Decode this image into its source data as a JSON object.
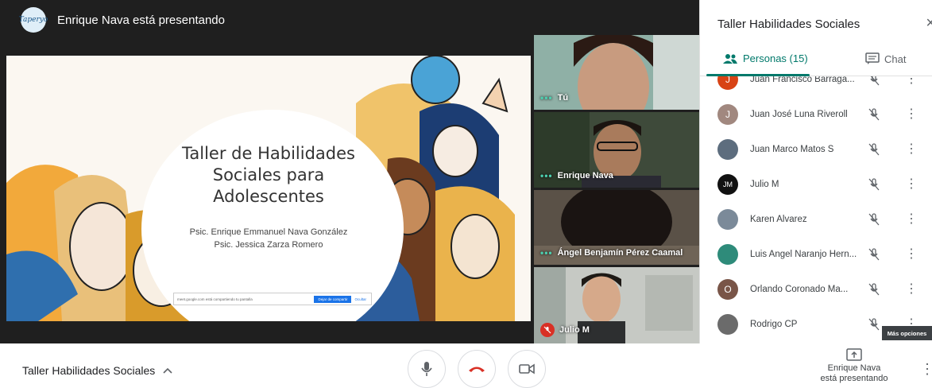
{
  "presenter": {
    "text": "Enrique Nava está presentando",
    "avatar_text": "Taperyo"
  },
  "slide": {
    "title": "Taller de Habilidades Sociales para Adolescentes",
    "subtitle_line1": "Psic. Enrique Emmanuel Nava González",
    "subtitle_line2": "Psic. Jessica Zarza Romero",
    "share_message": "meet.google.com está compartiendo tu pantalla",
    "stop_sharing": "Dejar de compartir",
    "hide": "Ocultar"
  },
  "tiles": [
    {
      "name": "Tú"
    },
    {
      "name": "Enrique Nava"
    },
    {
      "name": "Ángel Benjamín Pérez Caamal"
    },
    {
      "name": "Julio M"
    }
  ],
  "panel": {
    "title": "Taller Habilidades Sociales",
    "close": "×",
    "tab_people": "Personas (15)",
    "tab_chat": "Chat",
    "people": [
      {
        "name": "Juan Francisco Barraga...",
        "initial": "J",
        "color": "#d84315"
      },
      {
        "name": "Juan José Luna Riveroll",
        "initial": "J",
        "color": "#a1887f"
      },
      {
        "name": "Juan Marco Matos S",
        "initial": "",
        "color": "#5d6d7e"
      },
      {
        "name": "Julio M",
        "initial": "JM",
        "color": "#111111"
      },
      {
        "name": "Karen Alvarez",
        "initial": "",
        "color": "#7b8a99"
      },
      {
        "name": "Luis Angel Naranjo Hern...",
        "initial": "",
        "color": "#2e8b7a"
      },
      {
        "name": "Orlando Coronado Ma...",
        "initial": "O",
        "color": "#795548"
      },
      {
        "name": "Rodrigo CP",
        "initial": "",
        "color": "#6b6b6b"
      }
    ],
    "tooltip": "Más opciones"
  },
  "bottom": {
    "meeting_name": "Taller Habilidades Sociales",
    "present_line1": "Enrique Nava",
    "present_line2": "está presentando"
  },
  "colors": {
    "accent": "#00796b",
    "hangup": "#d93025",
    "stop_share": "#1a73e8"
  },
  "icons": [
    "chevron-up-icon",
    "mic-icon",
    "hangup-icon",
    "camera-icon",
    "present-icon",
    "more-vert-icon",
    "people-icon",
    "chat-icon",
    "mic-off-icon",
    "close-icon"
  ]
}
